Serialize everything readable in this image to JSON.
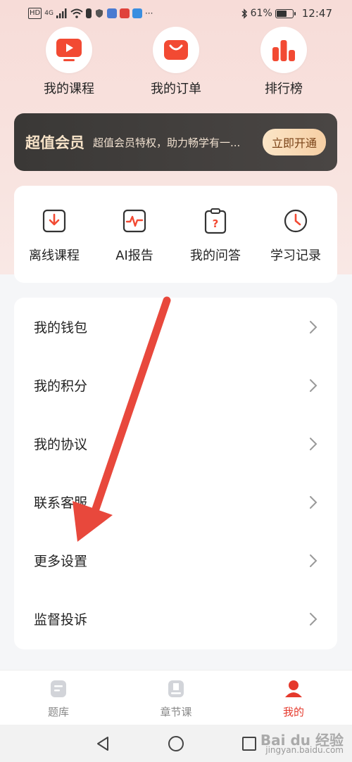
{
  "status_bar": {
    "left_icons": [
      "HD",
      "4G"
    ],
    "battery": "61%",
    "time": "12:47"
  },
  "shortcuts": [
    {
      "label": "我的课程",
      "icon": "course-play-icon"
    },
    {
      "label": "我的订单",
      "icon": "order-bag-icon"
    },
    {
      "label": "排行榜",
      "icon": "ranking-bars-icon"
    }
  ],
  "vip": {
    "title": "超值会员",
    "desc": "超值会员特权，助力畅学有一...",
    "button": "立即开通"
  },
  "tools": [
    {
      "label": "离线课程",
      "icon": "download-icon"
    },
    {
      "label": "AI报告",
      "icon": "report-pulse-icon"
    },
    {
      "label": "我的问答",
      "icon": "question-clipboard-icon"
    },
    {
      "label": "学习记录",
      "icon": "clock-icon"
    }
  ],
  "menu": [
    {
      "label": "我的钱包"
    },
    {
      "label": "我的积分"
    },
    {
      "label": "我的协议"
    },
    {
      "label": "联系客服"
    },
    {
      "label": "更多设置"
    },
    {
      "label": "监督投诉"
    }
  ],
  "bottom_nav": [
    {
      "label": "题库",
      "active": false
    },
    {
      "label": "章节课",
      "active": false
    },
    {
      "label": "我的",
      "active": true
    }
  ],
  "watermark": {
    "brand": "Bai du 经验",
    "url": "jingyan.baidu.com"
  },
  "colors": {
    "accent": "#e5392c",
    "vip_gold": "#f7e3c8"
  }
}
